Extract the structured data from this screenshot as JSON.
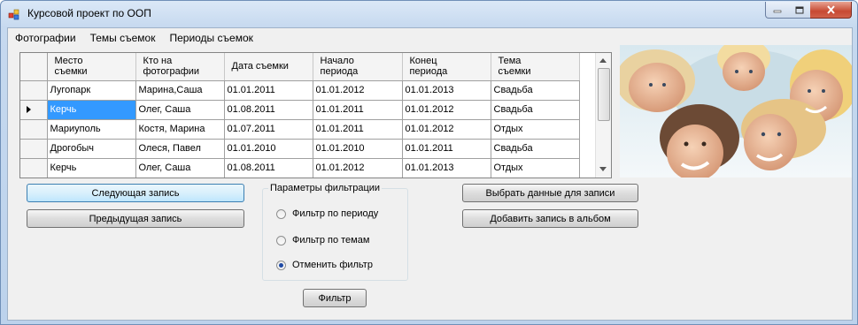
{
  "window": {
    "title": "Курсовой проект по ООП"
  },
  "menu": [
    "Фотографии",
    "Темы съемок",
    "Периоды съемок"
  ],
  "grid": {
    "columns": [
      "Место\nсъемки",
      "Кто на\nфотографии",
      "Дата съемки",
      "Начало\nпериода",
      "Конец\nпериода",
      "Тема\nсъемки"
    ],
    "rows": [
      [
        "Лугопарк",
        "Марина,Саша",
        "01.01.2011",
        "01.01.2012",
        "01.01.2013",
        "Свадьба"
      ],
      [
        "Керчь",
        "Олег, Саша",
        "01.08.2011",
        "01.01.2011",
        "01.01.2012",
        "Свадьба"
      ],
      [
        "Мариуполь",
        "Костя, Марина",
        "01.07.2011",
        "01.01.2011",
        "01.01.2012",
        "Отдых"
      ],
      [
        "Дрогобыч",
        "Олеся, Павел",
        "01.01.2010",
        "01.01.2010",
        "01.01.2011",
        "Свадьба"
      ],
      [
        "Керчь",
        "Олег, Саша",
        "01.08.2011",
        "01.01.2012",
        "01.01.2013",
        "Отдых"
      ]
    ],
    "current_row": 1
  },
  "buttons": {
    "next": "Следующая запись",
    "prev": "Предыдущая запись",
    "select_data": "Выбрать данные для записи",
    "add_to_album": "Добавить запись в альбом",
    "filter": "Фильтр"
  },
  "filter_group": {
    "title": "Параметры фильтрации",
    "options": [
      "Фильтр по периоду",
      "Фильтр по темам",
      "Отменить фильтр"
    ],
    "selected": 2
  },
  "colors": {
    "selection": "#3399ff",
    "close_button": "#c74a33"
  }
}
